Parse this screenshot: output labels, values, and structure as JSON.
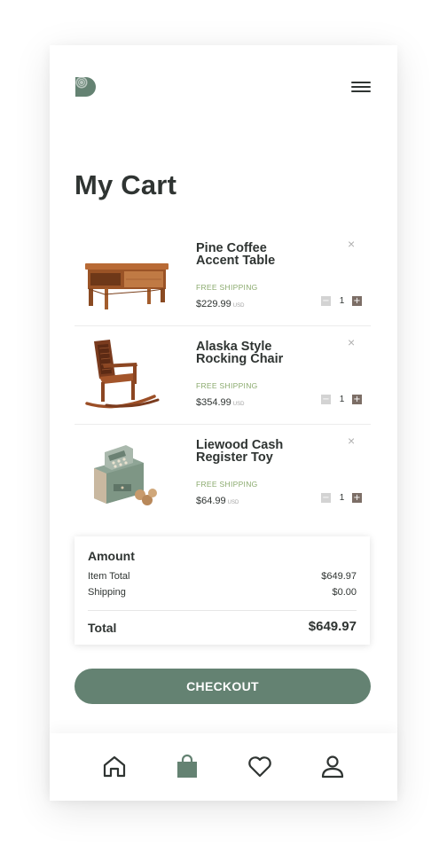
{
  "app": {
    "logo_icon": "brand-d-logo-icon",
    "menu_icon": "hamburger-menu-icon"
  },
  "colors": {
    "accent": "#648272",
    "text": "#2f3432",
    "shipping": "#8aaa6d",
    "plus_button": "#7c6e66"
  },
  "page": {
    "title": "My Cart"
  },
  "cart": {
    "items": [
      {
        "name": "Pine Coffee Accent Table",
        "shipping": "FREE SHIPPING",
        "price": "$229.99",
        "currency": "USD",
        "qty": "1",
        "remove": "×",
        "image_icon": "coffee-table-image"
      },
      {
        "name": "Alaska Style Rocking Chair",
        "shipping": "FREE SHIPPING",
        "price": "$354.99",
        "currency": "USD",
        "qty": "1",
        "remove": "×",
        "image_icon": "rocking-chair-image"
      },
      {
        "name": "Liewood Cash Register Toy",
        "shipping": "FREE SHIPPING",
        "price": "$64.99",
        "currency": "USD",
        "qty": "1",
        "remove": "×",
        "image_icon": "cash-register-toy-image"
      }
    ],
    "stepper": {
      "minus": "−",
      "plus": "+"
    }
  },
  "amount": {
    "heading": "Amount",
    "item_total_label": "Item Total",
    "item_total_value": "$649.97",
    "shipping_label": "Shipping",
    "shipping_value": "$0.00",
    "total_label": "Total",
    "total_value": "$649.97"
  },
  "checkout": {
    "label": "CHECKOUT"
  },
  "tabbar": {
    "items": [
      {
        "icon": "home-icon",
        "active": false
      },
      {
        "icon": "shopping-bag-icon",
        "active": true
      },
      {
        "icon": "heart-icon",
        "active": false
      },
      {
        "icon": "user-icon",
        "active": false
      }
    ]
  }
}
